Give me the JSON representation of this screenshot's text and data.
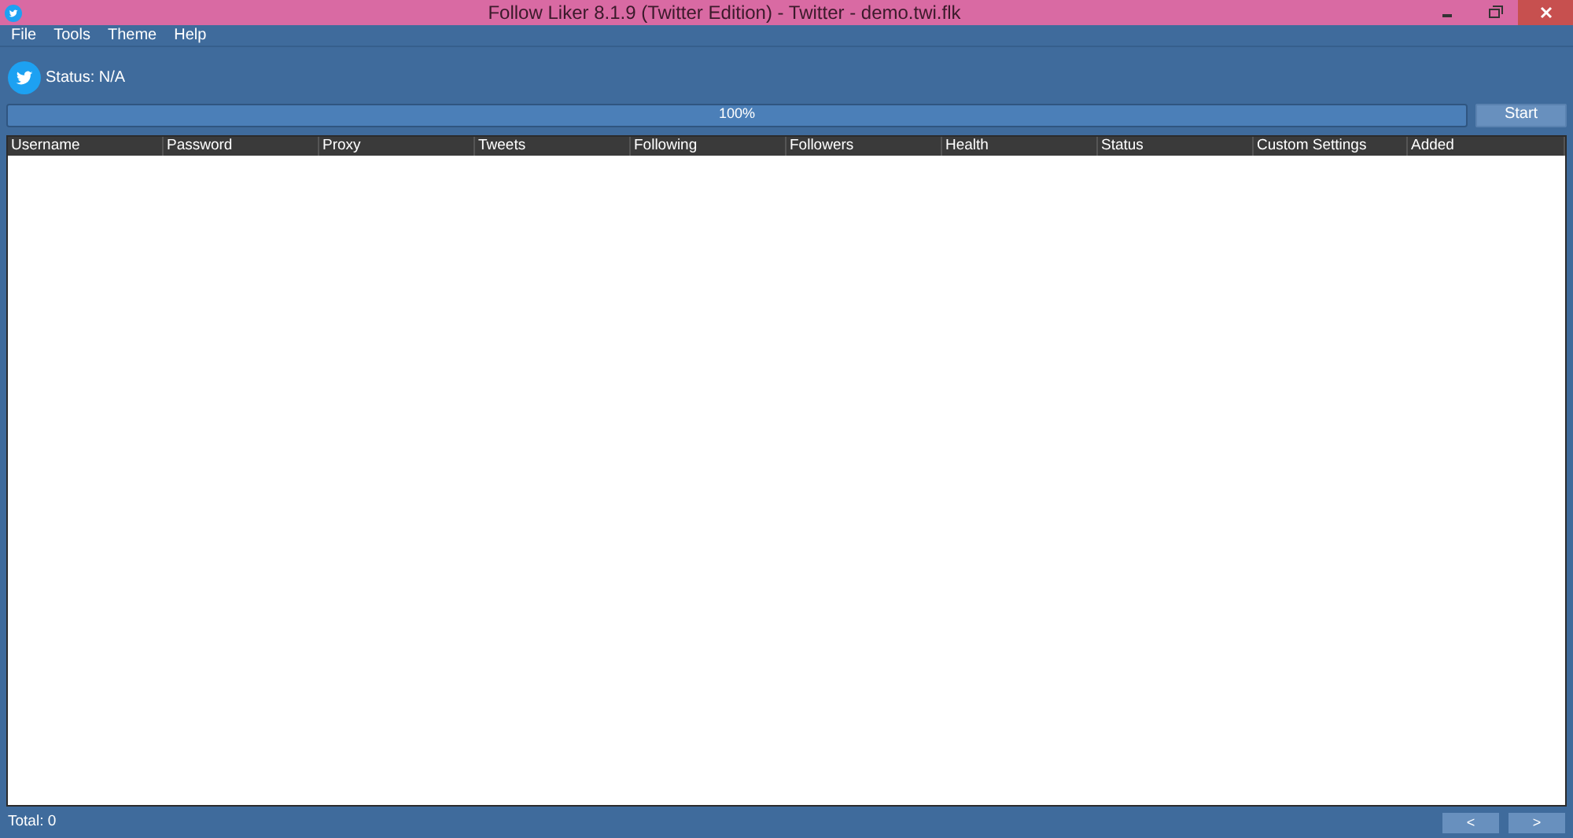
{
  "window": {
    "title": "Follow Liker 8.1.9 (Twitter Edition) - Twitter - demo.twi.flk"
  },
  "menu": [
    "File",
    "Tools",
    "Theme",
    "Help"
  ],
  "status": {
    "label": "Status: N/A"
  },
  "progress": {
    "level": 1,
    "reading": "100%"
  },
  "start_button": "Start",
  "table": {
    "columns": [
      "Username",
      "Password",
      "Proxy",
      "Tweets",
      "Following",
      "Followers",
      "Health",
      "Status",
      "Custom Settings",
      "Added"
    ]
  },
  "footer": {
    "total": "Total: 0",
    "prev": "<",
    "next": ">"
  }
}
